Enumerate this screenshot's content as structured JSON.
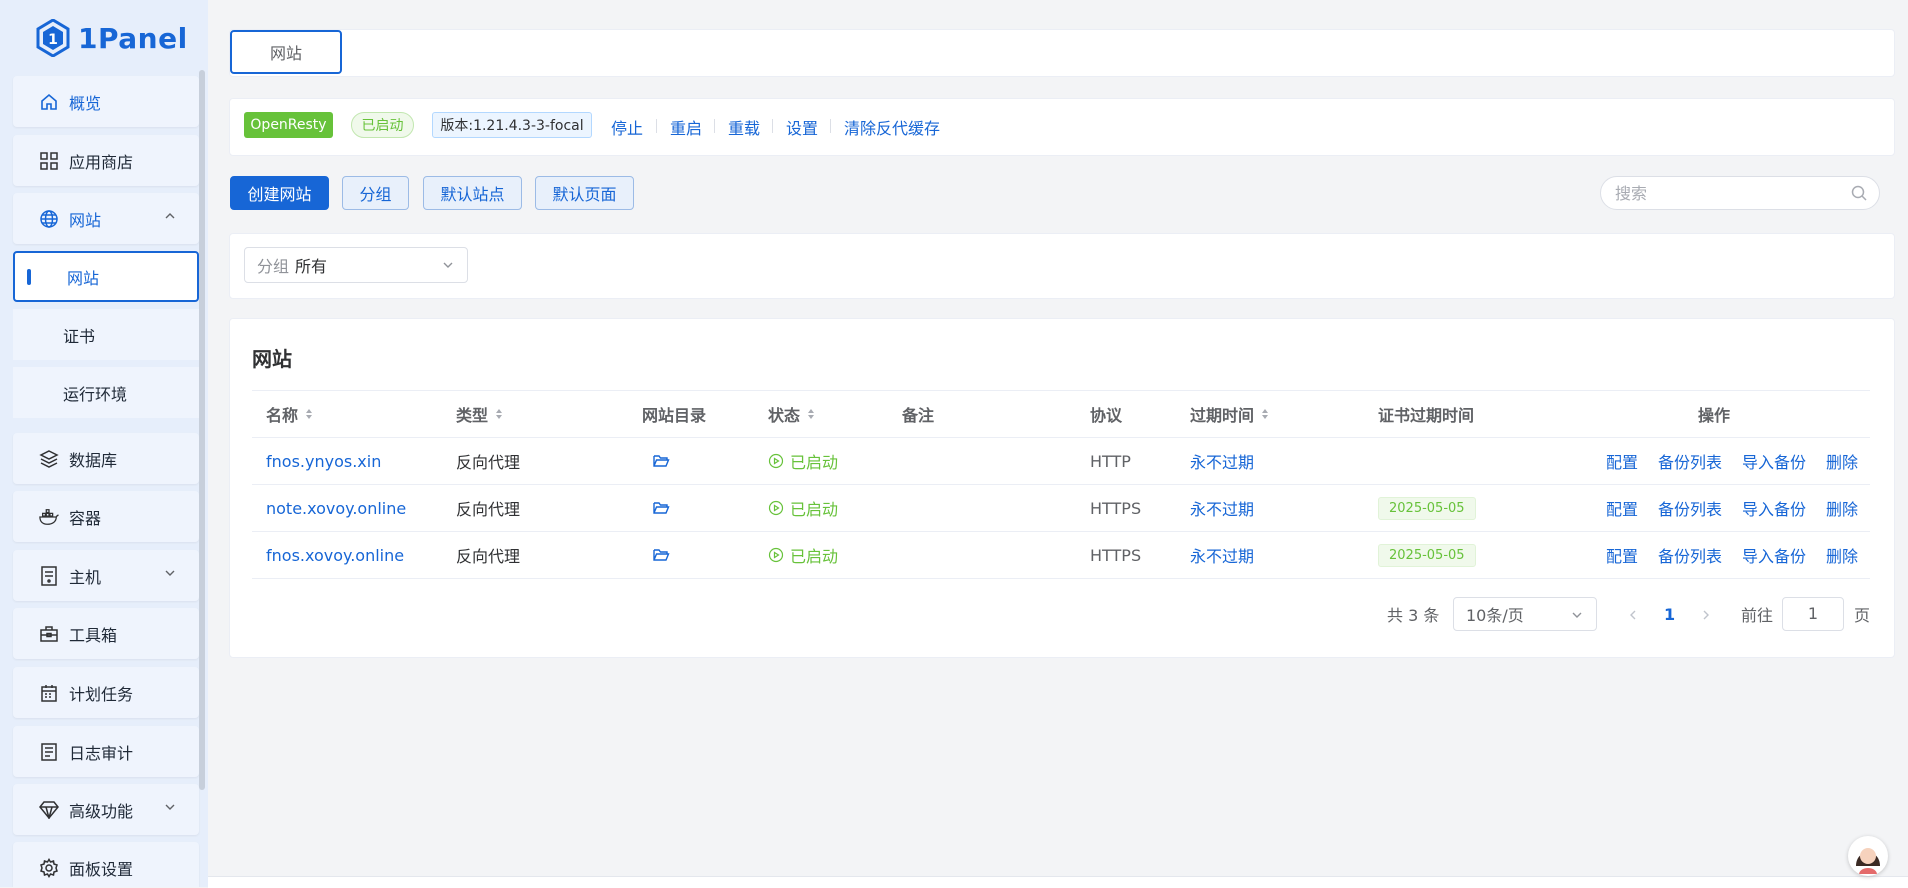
{
  "app": {
    "logo_text": "1Panel"
  },
  "sidebar": {
    "items": [
      {
        "label": "概览",
        "icon": "home-icon"
      },
      {
        "label": "应用商店",
        "icon": "apps-icon"
      },
      {
        "label": "网站",
        "icon": "globe-icon",
        "expanded": true
      },
      {
        "label": "数据库",
        "icon": "layers-icon"
      },
      {
        "label": "容器",
        "icon": "docker-icon"
      },
      {
        "label": "主机",
        "icon": "server-icon"
      },
      {
        "label": "工具箱",
        "icon": "toolbox-icon"
      },
      {
        "label": "计划任务",
        "icon": "calendar-icon"
      },
      {
        "label": "日志审计",
        "icon": "log-icon"
      },
      {
        "label": "高级功能",
        "icon": "diamond-icon"
      },
      {
        "label": "面板设置",
        "icon": "gear-icon"
      }
    ],
    "website_sub": [
      {
        "label": "网站",
        "selected": true
      },
      {
        "label": "证书"
      },
      {
        "label": "运行环境"
      }
    ]
  },
  "tabs": {
    "active": "网站"
  },
  "openresty": {
    "name": "OpenResty",
    "status": "已启动",
    "version": "版本:1.21.4.3-3-focal",
    "actions": [
      "停止",
      "重启",
      "重载",
      "设置",
      "清除反代缓存"
    ]
  },
  "toolbar": {
    "create": "创建网站",
    "group": "分组",
    "default_site": "默认站点",
    "default_page": "默认页面",
    "search_placeholder": "搜索"
  },
  "filter": {
    "prefix": "分组",
    "value": "所有"
  },
  "table": {
    "title": "网站",
    "columns": [
      "名称",
      "类型",
      "网站目录",
      "状态",
      "备注",
      "协议",
      "过期时间",
      "证书过期时间",
      "操作"
    ],
    "rows": [
      {
        "name": "fnos.ynyos.xin",
        "type": "反向代理",
        "status": "已启动",
        "remark": "",
        "protocol": "HTTP",
        "expire": "永不过期",
        "cert_expire": ""
      },
      {
        "name": "note.xovoy.online",
        "type": "反向代理",
        "status": "已启动",
        "remark": "",
        "protocol": "HTTPS",
        "expire": "永不过期",
        "cert_expire": "2025-05-05"
      },
      {
        "name": "fnos.xovoy.online",
        "type": "反向代理",
        "status": "已启动",
        "remark": "",
        "protocol": "HTTPS",
        "expire": "永不过期",
        "cert_expire": "2025-05-05"
      }
    ],
    "row_actions": [
      "配置",
      "备份列表",
      "导入备份",
      "删除"
    ]
  },
  "pagination": {
    "total": "共 3 条",
    "page_size": "10条/页",
    "current": "1",
    "goto_label": "前往",
    "goto_value": "1",
    "page_suffix": "页"
  },
  "colors": {
    "primary": "#1766d6",
    "success": "#67c23a",
    "sidebar_bg": "#e6eefb"
  }
}
